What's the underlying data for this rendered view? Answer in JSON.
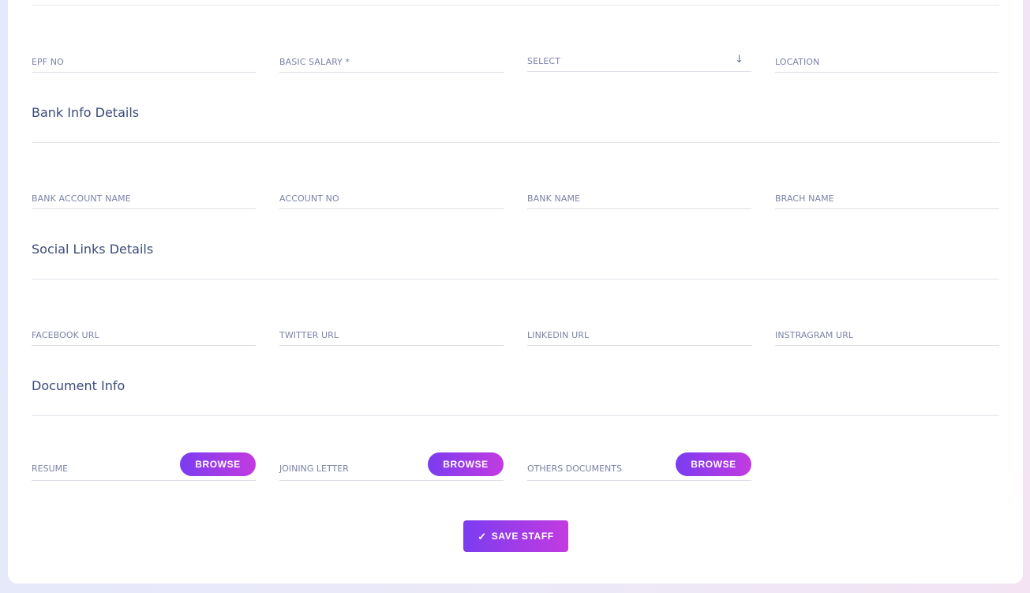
{
  "employment": {
    "epf_no": "EPF NO",
    "basic_salary": "BASIC SALARY *",
    "select": "SELECT",
    "select_icon": "arrow-down-icon",
    "location": "LOCATION"
  },
  "bank": {
    "title": "Bank Info Details",
    "account_name": "BANK ACCOUNT NAME",
    "account_no": "ACCOUNT NO",
    "bank_name": "BANK NAME",
    "branch_name": "BRACH NAME"
  },
  "social": {
    "title": "Social Links Details",
    "facebook": "FACEBOOK URL",
    "twitter": "TWITTER URL",
    "linkedin": "LINKEDIN URL",
    "instagram": "INSTRAGRAM URL"
  },
  "documents": {
    "title": "Document Info",
    "resume": "RESUME",
    "joining_letter": "JOINING LETTER",
    "others": "OTHERS DOCUMENTS",
    "browse_label": "BROWSE"
  },
  "actions": {
    "save_label": "SAVE STAFF",
    "save_icon": "check-icon"
  },
  "colors": {
    "accent_start": "#7b3cf0",
    "accent_end": "#c33be0",
    "heading": "#3b4a7a",
    "label": "#7b83a6"
  }
}
